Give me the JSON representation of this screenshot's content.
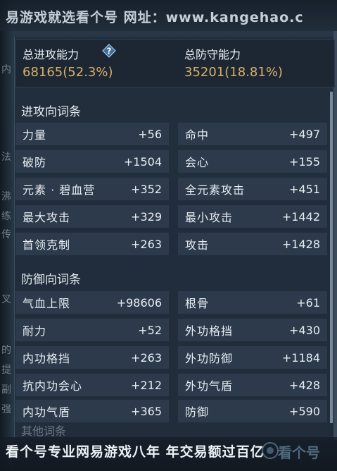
{
  "watermark": {
    "top_text": "易游戏就选看个号  网址：www.kangehao.c",
    "bottom_text": "看个号专业网易游戏八年  年交易额过百亿",
    "logo_text": "看个号",
    "bottom_faded": "其他词条"
  },
  "left_strip_chars": [
    "内",
    "法",
    "沸",
    "练",
    "传",
    "叉",
    "的",
    "提",
    "副",
    "强"
  ],
  "summary": {
    "attack_label": "总进攻能力",
    "attack_value": "68165(52.3%)",
    "defense_label": "总防守能力",
    "defense_value": "35201(18.81%)"
  },
  "attack_section": {
    "title": "进攻向词条",
    "left": [
      {
        "name": "力量",
        "value": "+56"
      },
      {
        "name": "破防",
        "value": "+1504"
      },
      {
        "name": "元素 · 碧血营",
        "value": "+352"
      },
      {
        "name": "最大攻击",
        "value": "+329"
      },
      {
        "name": "首领克制",
        "value": "+263"
      }
    ],
    "right": [
      {
        "name": "命中",
        "value": "+497"
      },
      {
        "name": "会心",
        "value": "+155"
      },
      {
        "name": "全元素攻击",
        "value": "+451"
      },
      {
        "name": "最小攻击",
        "value": "+1442"
      },
      {
        "name": "攻击",
        "value": "+1428"
      }
    ]
  },
  "defense_section": {
    "title": "防御向词条",
    "left": [
      {
        "name": "气血上限",
        "value": "+98606"
      },
      {
        "name": "耐力",
        "value": "+52"
      },
      {
        "name": "内功格挡",
        "value": "+263"
      },
      {
        "name": "抗内功会心",
        "value": "+212"
      },
      {
        "name": "内功气盾",
        "value": "+365"
      }
    ],
    "right": [
      {
        "name": "根骨",
        "value": "+61"
      },
      {
        "name": "外功格挡",
        "value": "+430"
      },
      {
        "name": "外功防御",
        "value": "+1184"
      },
      {
        "name": "外功气盾",
        "value": "+428"
      },
      {
        "name": "防御",
        "value": "+590"
      }
    ]
  },
  "colors": {
    "value_gold": "#d8b06a",
    "panel_bg": "#222e3c",
    "row_bg": "#2c3a4b"
  }
}
